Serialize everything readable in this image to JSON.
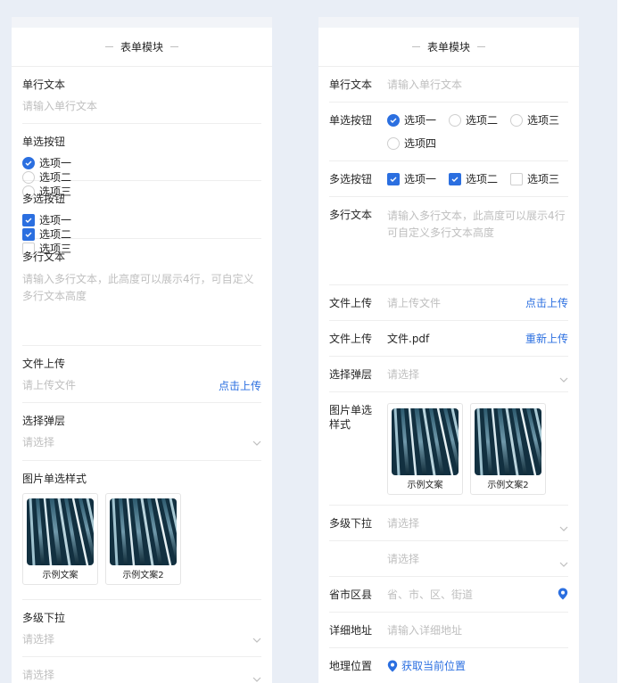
{
  "colors": {
    "accent": "#2b6fe0",
    "muted": "#bfbfbf",
    "text": "#262626",
    "divider": "#eeeeee"
  },
  "header": {
    "title": "表单模块"
  },
  "left": {
    "single_text": {
      "label": "单行文本",
      "placeholder": "请输入单行文本"
    },
    "radio": {
      "label": "单选按钮",
      "options": [
        "选项一",
        "选项二",
        "选项三"
      ]
    },
    "checkbox": {
      "label": "多选按钮",
      "options": [
        "选项一",
        "选项二",
        "选项三"
      ]
    },
    "multi_text": {
      "label": "多行文本",
      "placeholder": "请输入多行文本，此高度可以展示4行，可自定义多行文本高度"
    },
    "upload": {
      "label": "文件上传",
      "placeholder": "请上传文件",
      "action": "点击上传"
    },
    "picker": {
      "label": "选择弹层",
      "placeholder": "请选择"
    },
    "image_select": {
      "label": "图片单选样式",
      "captions": [
        "示例文案",
        "示例文案2"
      ]
    },
    "cascade": {
      "label": "多级下拉",
      "placeholders": [
        "请选择",
        "请选择"
      ]
    }
  },
  "right": {
    "single_text": {
      "label": "单行文本",
      "placeholder": "请输入单行文本"
    },
    "radio": {
      "label": "单选按钮",
      "options": [
        "选项一",
        "选项二",
        "选项三",
        "选项四"
      ]
    },
    "checkbox": {
      "label": "多选按钮",
      "options": [
        "选项一",
        "选项二",
        "选项三"
      ]
    },
    "multi_text": {
      "label": "多行文本",
      "placeholder": "请输入多行文本，此高度可以展示4行可自定义多行文本高度"
    },
    "upload": {
      "label": "文件上传",
      "placeholder": "请上传文件",
      "action": "点击上传"
    },
    "upload_done": {
      "label": "文件上传",
      "filename": "文件.pdf",
      "action": "重新上传"
    },
    "picker": {
      "label": "选择弹层",
      "placeholder": "请选择"
    },
    "image_select": {
      "label": "图片单选样式",
      "captions": [
        "示例文案",
        "示例文案2"
      ]
    },
    "cascade": {
      "label": "多级下拉",
      "placeholders": [
        "请选择",
        "请选择"
      ]
    },
    "region": {
      "label": "省市区县",
      "placeholder": "省、市、区、街道"
    },
    "address": {
      "label": "详细地址",
      "placeholder": "请输入详细地址"
    },
    "location": {
      "label": "地理位置",
      "action": "获取当前位置"
    }
  }
}
